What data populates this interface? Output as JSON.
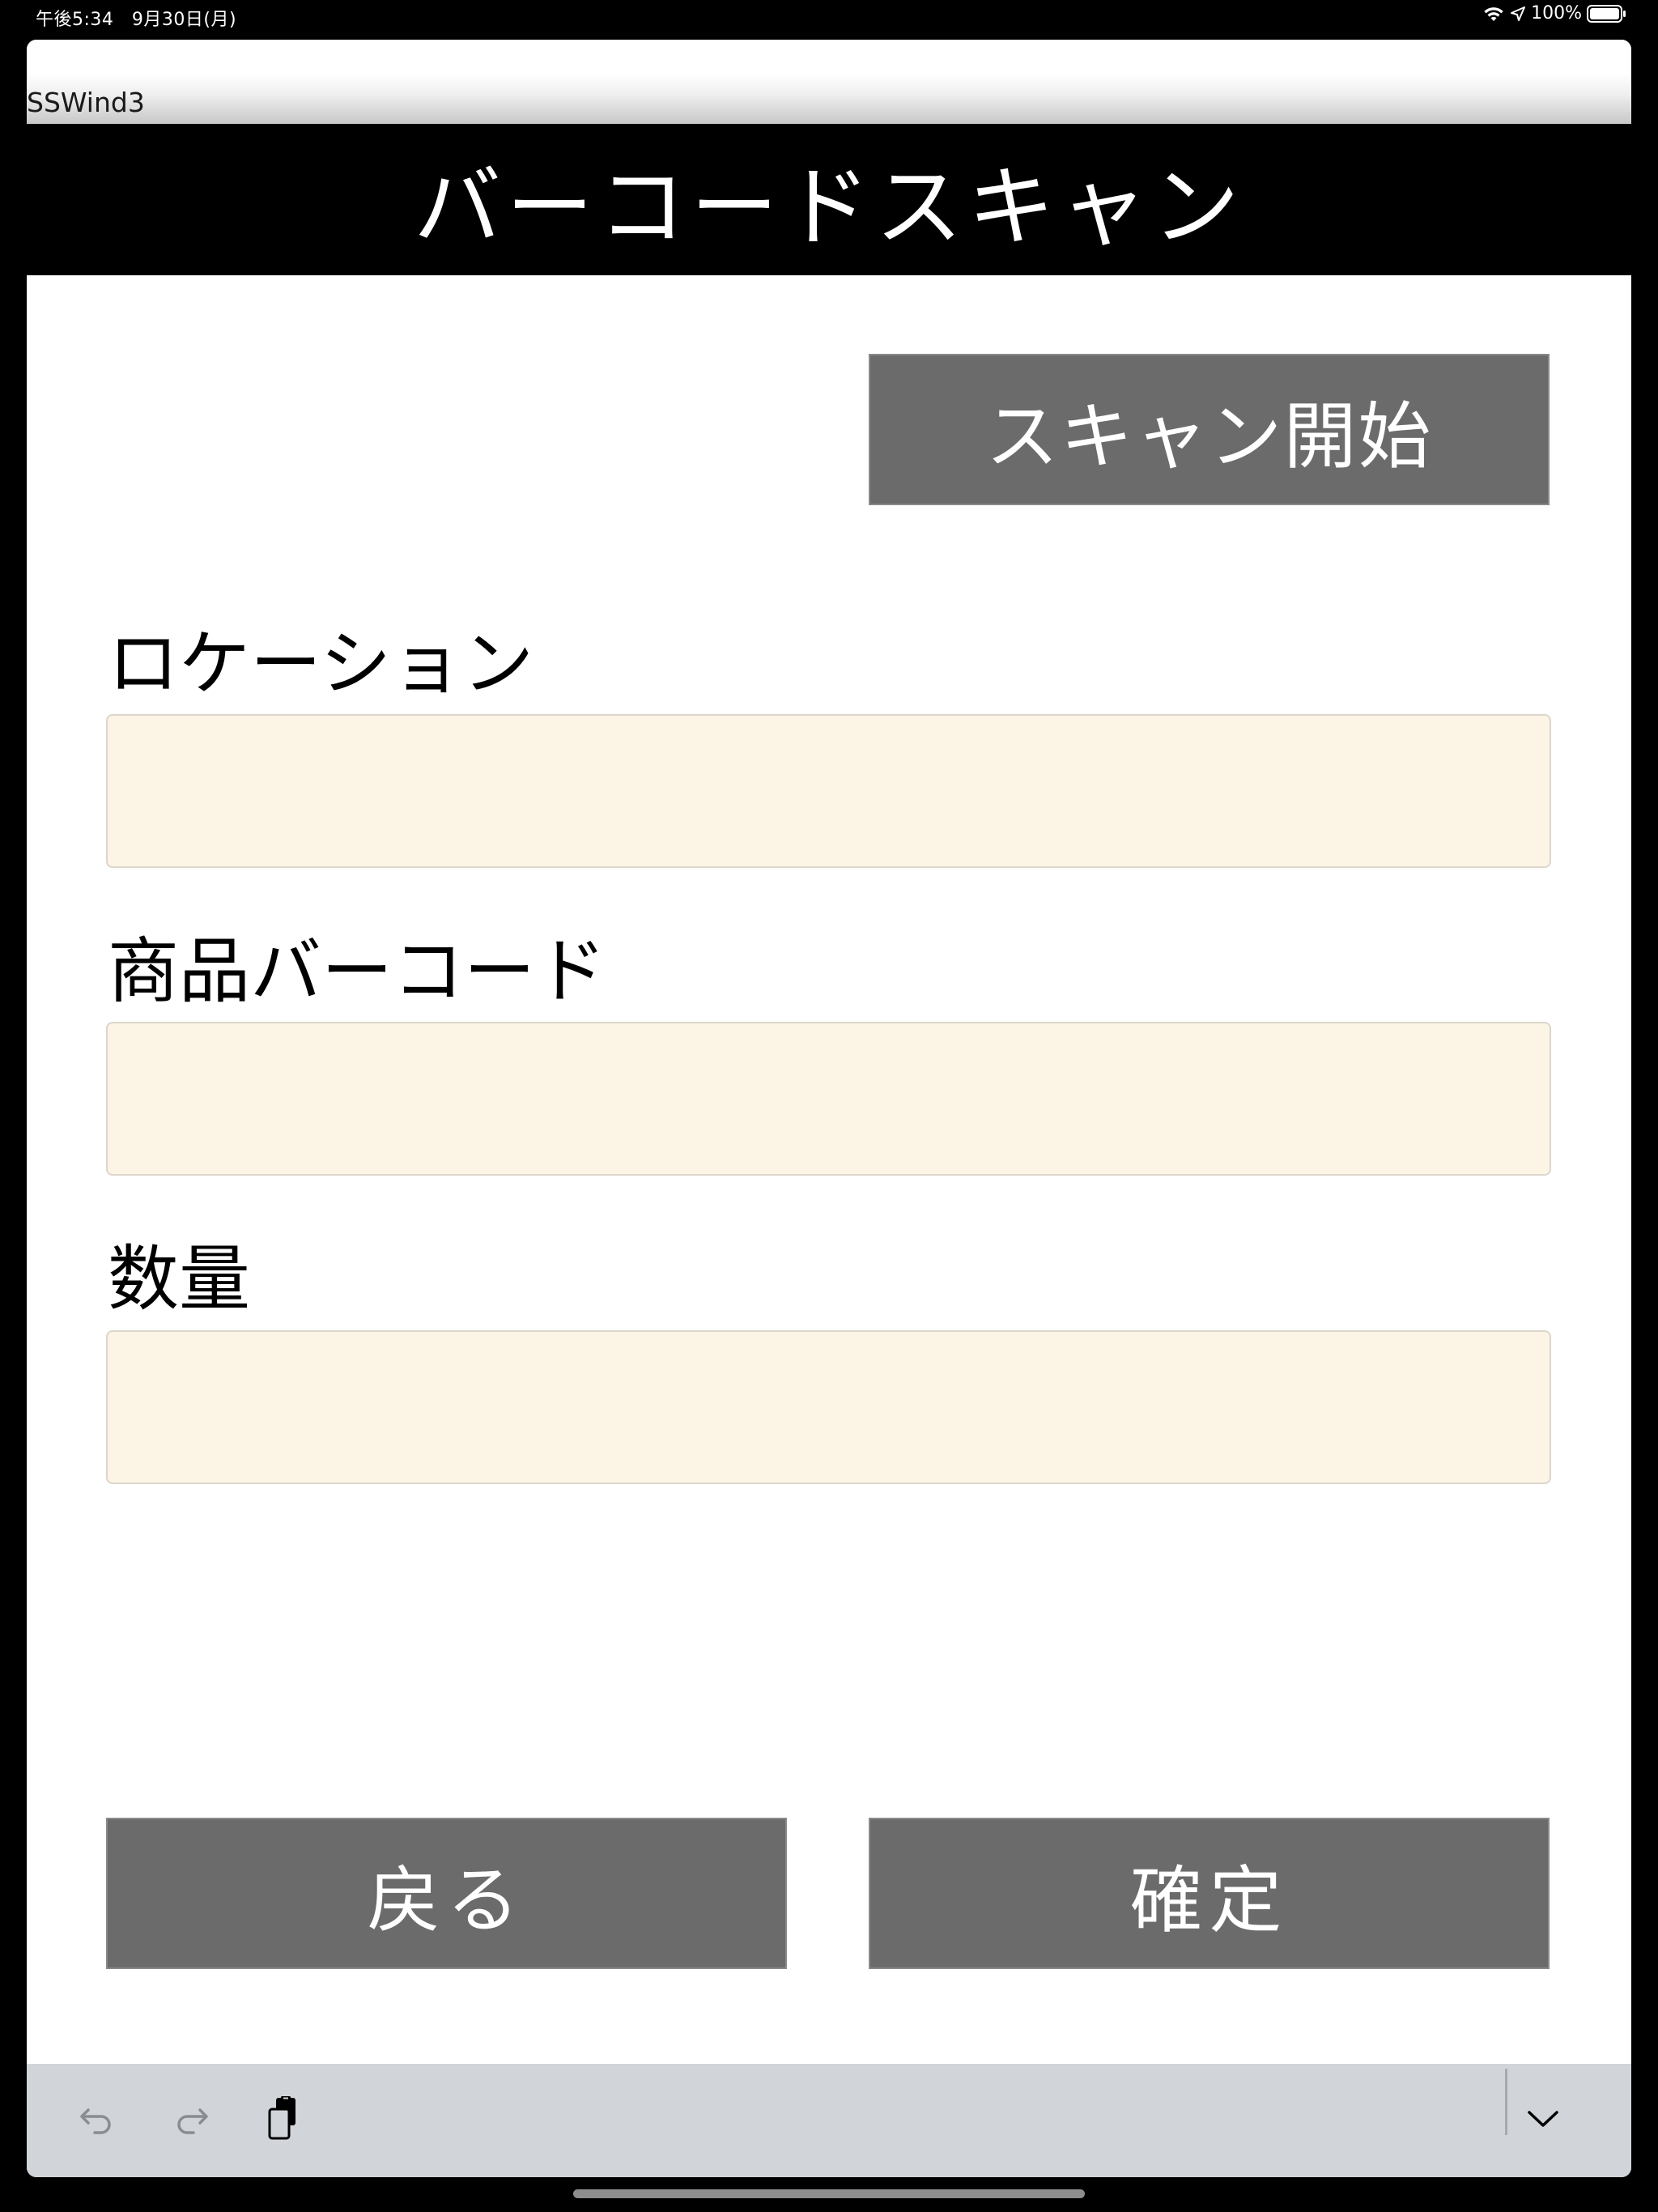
{
  "status_bar": {
    "time_date": "午後5:34　9月30日(月)",
    "battery_percent": "100%",
    "battery_level": 1.0,
    "icons": [
      "wifi-icon",
      "location-arrow-icon",
      "battery-icon"
    ]
  },
  "window": {
    "title": "SSWind3"
  },
  "header": {
    "title": "バーコードスキャン"
  },
  "scan_button": {
    "label": "スキャン開始"
  },
  "form": {
    "location": {
      "label": "ロケーション",
      "value": "",
      "placeholder": ""
    },
    "barcode": {
      "label": "商品バーコード",
      "value": "",
      "placeholder": ""
    },
    "quantity": {
      "label": "数量",
      "value": "",
      "placeholder": ""
    }
  },
  "actions": {
    "back_label": "戻る",
    "confirm_label": "確定"
  },
  "shortcut_bar": {
    "icons": [
      "undo-icon",
      "redo-icon",
      "paste-icon",
      "chevron-down-icon"
    ]
  },
  "colors": {
    "header_bg": "#000000",
    "button_bg": "#6b6b6b",
    "input_bg": "#fcf5e6",
    "shortcut_bar_bg": "#d1d4d9"
  }
}
